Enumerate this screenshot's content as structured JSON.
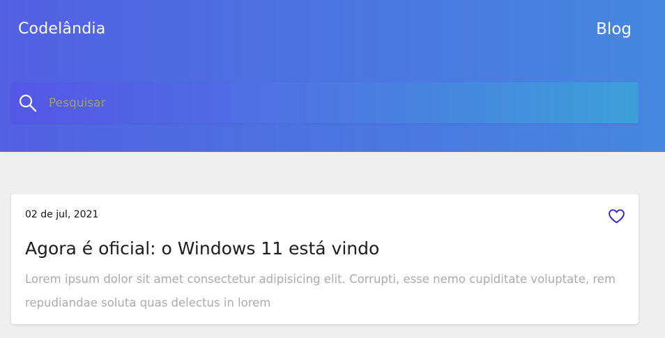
{
  "header": {
    "brand": "Codelândia",
    "nav_link": "Blog"
  },
  "search": {
    "placeholder": "Pesquisar",
    "icon": "search-icon"
  },
  "post": {
    "date": "02 de jul, 2021",
    "title": "Agora é oficial: o Windows 11 está vindo",
    "excerpt": "Lorem ipsum dolor sit amet consectetur adipisicing elit. Corrupti, esse nemo cupiditate voluptate, rem repudiandae soluta quas delectus in lorem",
    "like_icon": "heart-icon"
  },
  "colors": {
    "header_start": "#5360e2",
    "header_end": "#4688df",
    "heart": "#2f22d6",
    "background": "#efefef"
  }
}
